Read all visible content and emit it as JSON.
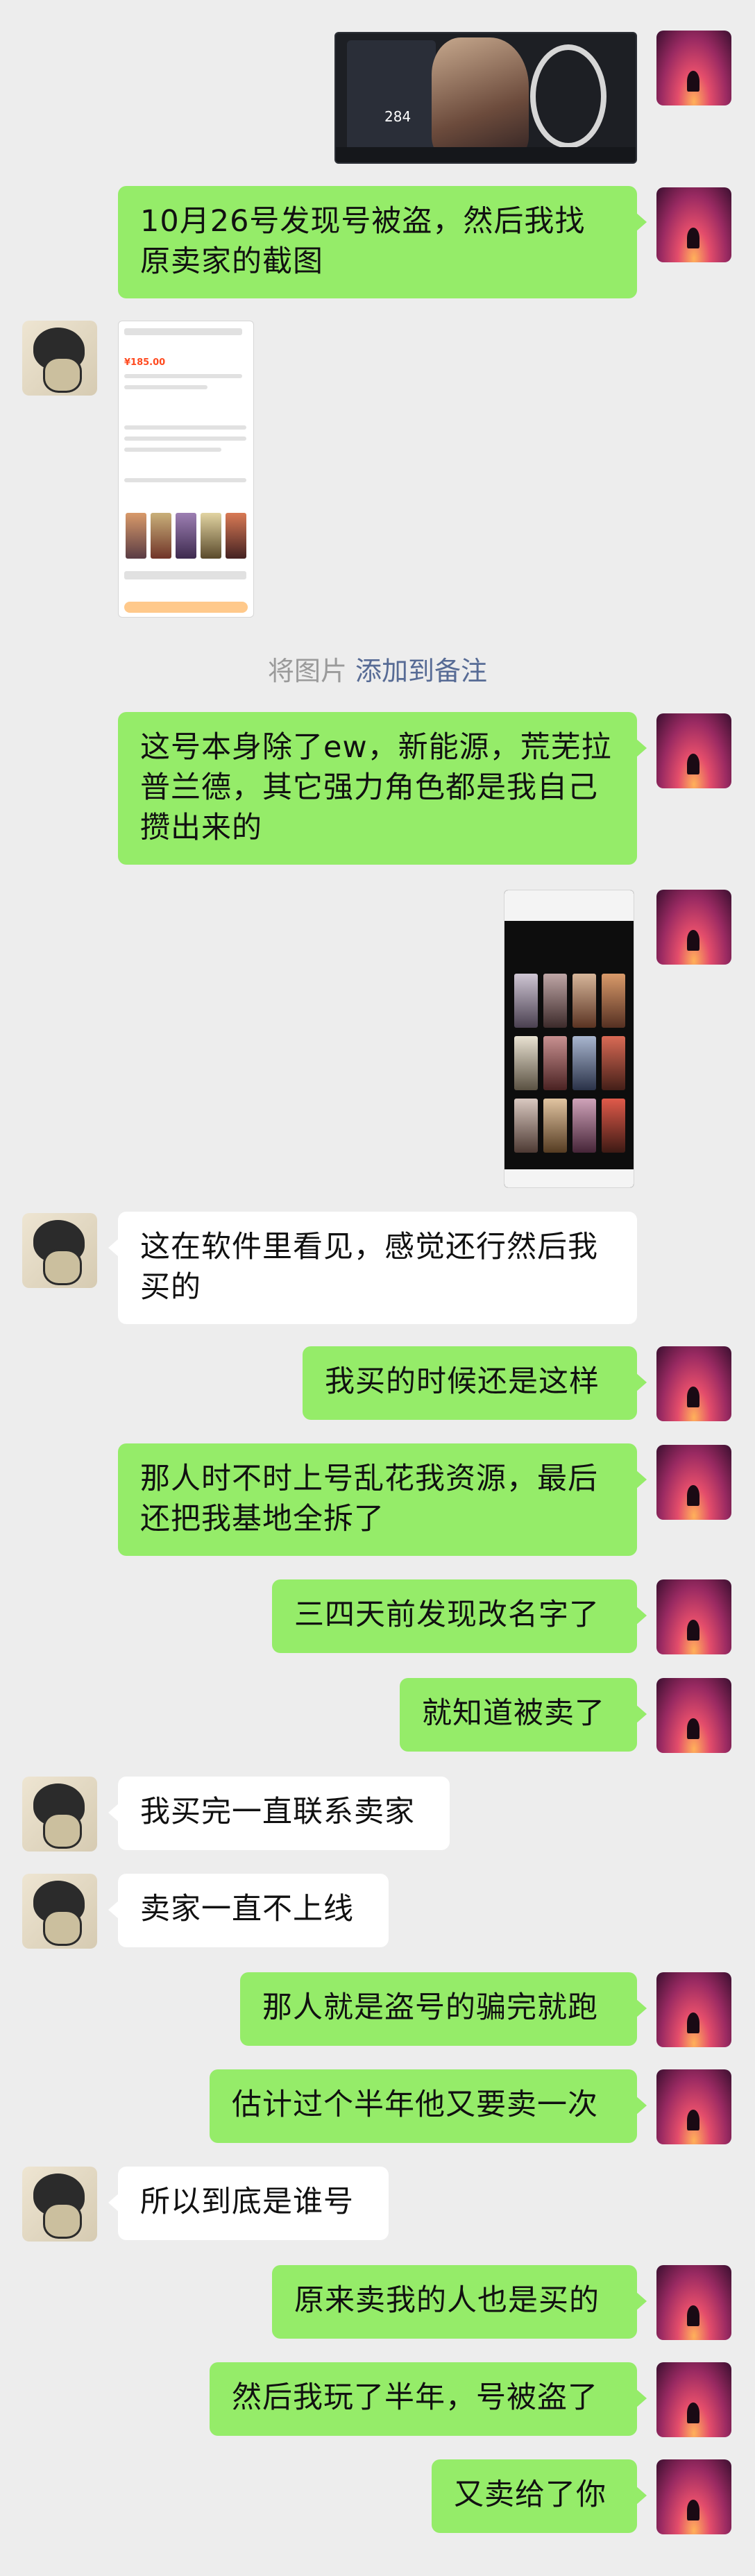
{
  "chat": {
    "system_note": {
      "prefix": "将图片",
      "link": "添加到备注"
    },
    "img_game": {
      "value": "284"
    },
    "img_shop": {
      "price": "¥185.00"
    },
    "messages": [
      {
        "from": "me",
        "text": "10月26号发现号被盗，然后我找原卖家的截图"
      },
      {
        "from": "me",
        "text": "这号本身除了ew，新能源，荒芜拉普兰德，其它强力角色都是我自己攒出来的"
      },
      {
        "from": "them",
        "text": "这在软件里看见，感觉还行然后我买的"
      },
      {
        "from": "me",
        "text": "我买的时候还是这样"
      },
      {
        "from": "me",
        "text": "那人时不时上号乱花我资源，最后还把我基地全拆了"
      },
      {
        "from": "me",
        "text": "三四天前发现改名字了"
      },
      {
        "from": "me",
        "text": "就知道被卖了"
      },
      {
        "from": "them",
        "text": "我买完一直联系卖家"
      },
      {
        "from": "them",
        "text": "卖家一直不上线"
      },
      {
        "from": "me",
        "text": "那人就是盗号的骗完就跑"
      },
      {
        "from": "me",
        "text": "估计过个半年他又要卖一次"
      },
      {
        "from": "them",
        "text": "所以到底是谁号"
      },
      {
        "from": "me",
        "text": "原来卖我的人也是买的"
      },
      {
        "from": "me",
        "text": "然后我玩了半年，号被盗了"
      },
      {
        "from": "me",
        "text": "又卖给了你"
      }
    ]
  }
}
